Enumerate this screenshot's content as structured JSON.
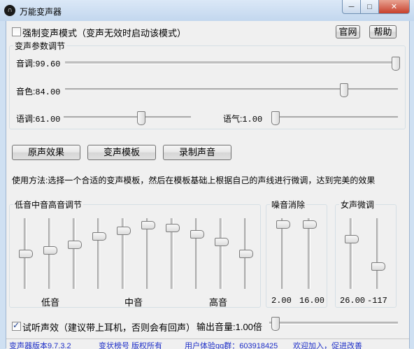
{
  "window": {
    "title": "万能变声器",
    "icon": "headphones-icon",
    "controls": {
      "minimize": "─",
      "maximize": "□",
      "close": "✕"
    }
  },
  "top": {
    "force_mode_label": "强制变声模式（变声无效时启动该模式）",
    "force_mode_checked": false,
    "website_button": "官网",
    "help_button": "帮助"
  },
  "params": {
    "legend": "变声参数调节",
    "pitch": {
      "label": "音调:",
      "value": "99.60",
      "level": 0.996
    },
    "timbre": {
      "label": "音色:",
      "value": "84.00",
      "level": 0.84
    },
    "tone": {
      "label": "语调:",
      "value": "61.00",
      "level": 0.61
    },
    "mood": {
      "label": "语气:",
      "value": "1.00",
      "level": 0.0
    }
  },
  "buttons": {
    "original": "原声效果",
    "templates": "变声模板",
    "record": "录制声音"
  },
  "usage_text": "使用方法:选择一个合适的变声模板，然后在模板基础上根据自己的声线进行微调，达到完美的效果",
  "eq": {
    "legend": "低音中音高音调节",
    "levels": [
      0.51,
      0.56,
      0.64,
      0.77,
      0.86,
      0.95,
      0.9,
      0.81,
      0.69,
      0.51
    ],
    "low_label": "低音",
    "mid_label": "中音",
    "high_label": "高音"
  },
  "noise": {
    "legend": "噪音消除",
    "sliders": [
      {
        "value": "2.00",
        "level": 0.96
      },
      {
        "value": "16.00",
        "level": 0.96
      }
    ]
  },
  "female": {
    "legend": "女声微调",
    "sliders": [
      {
        "value": "26.00",
        "level": 0.73
      },
      {
        "value": "-117",
        "level": 0.31
      }
    ]
  },
  "bottom": {
    "monitor_label": "试听声效（建议带上耳机，否则会有回声）",
    "monitor_checked": true,
    "volume_label": "输出音量:1.00倍",
    "volume_level": 0.0
  },
  "status": {
    "version": "变声器版本9.7.3.2",
    "copyright": "变状榜号 版权所有",
    "qq_group": "用户体验qq群：603918425",
    "join": "欢迎加入，促进改善"
  }
}
